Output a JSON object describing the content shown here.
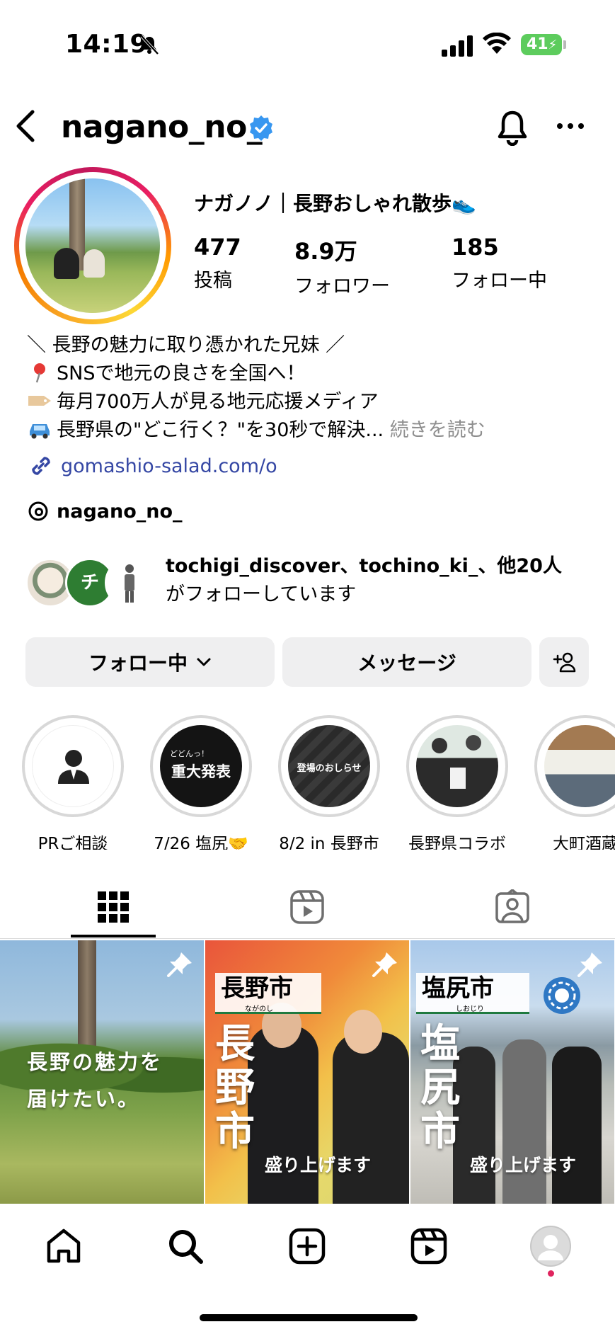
{
  "status_bar": {
    "time": "14:19",
    "battery": "41"
  },
  "header": {
    "username": "nagano_no_"
  },
  "profile": {
    "display_name": "ナガノノ｜長野おしゃれ散歩👟",
    "stats": [
      {
        "value": "477",
        "label": "投稿"
      },
      {
        "value": "8.9万",
        "label": "フォロワー"
      },
      {
        "value": "185",
        "label": "フォロー中"
      }
    ],
    "bio": [
      "＼ 長野の魅力に取り憑かれた兄妹 ／",
      "SNSで地元の良さを全国へ！",
      "毎月700万人が見る地元応援メディア",
      "長野県の\"どこ行く？\"を30秒で解決..."
    ],
    "bio_more": "続きを読む",
    "link": "gomashio-salad.com/o",
    "threads": "nagano_no_",
    "mutual_names": "tochigi_discover、tochino_ki_、他20人",
    "mutual_suffix": "がフォローしています"
  },
  "buttons": {
    "following": "フォロー中",
    "message": "メッセージ"
  },
  "highlights": [
    {
      "label": "PRご相談",
      "inner": ""
    },
    {
      "label": "7/26 塩尻🤝",
      "inner": "重大発表",
      "inner_small": "どどんっ！"
    },
    {
      "label": "8/2 in 長野市",
      "inner": "登場のおしらせ"
    },
    {
      "label": "長野県コラボ",
      "inner": ""
    },
    {
      "label": "大町酒蔵",
      "inner": ""
    }
  ],
  "posts": [
    {
      "text1": "長野の魅力を",
      "text2": "届けたい。"
    },
    {
      "badge": "長野市",
      "badge_sub": "ながのし",
      "big": [
        "長",
        "野",
        "市"
      ],
      "tail": "盛り上げます"
    },
    {
      "badge": "塩尻市",
      "badge_sub": "しおじり",
      "big": [
        "塩",
        "尻",
        "市"
      ],
      "tail": "盛り上げます"
    }
  ],
  "colors": {
    "link": "#3547a4",
    "verified": "#3897f0",
    "button_bg": "#efeff0",
    "notif_dot": "#e0245e"
  }
}
